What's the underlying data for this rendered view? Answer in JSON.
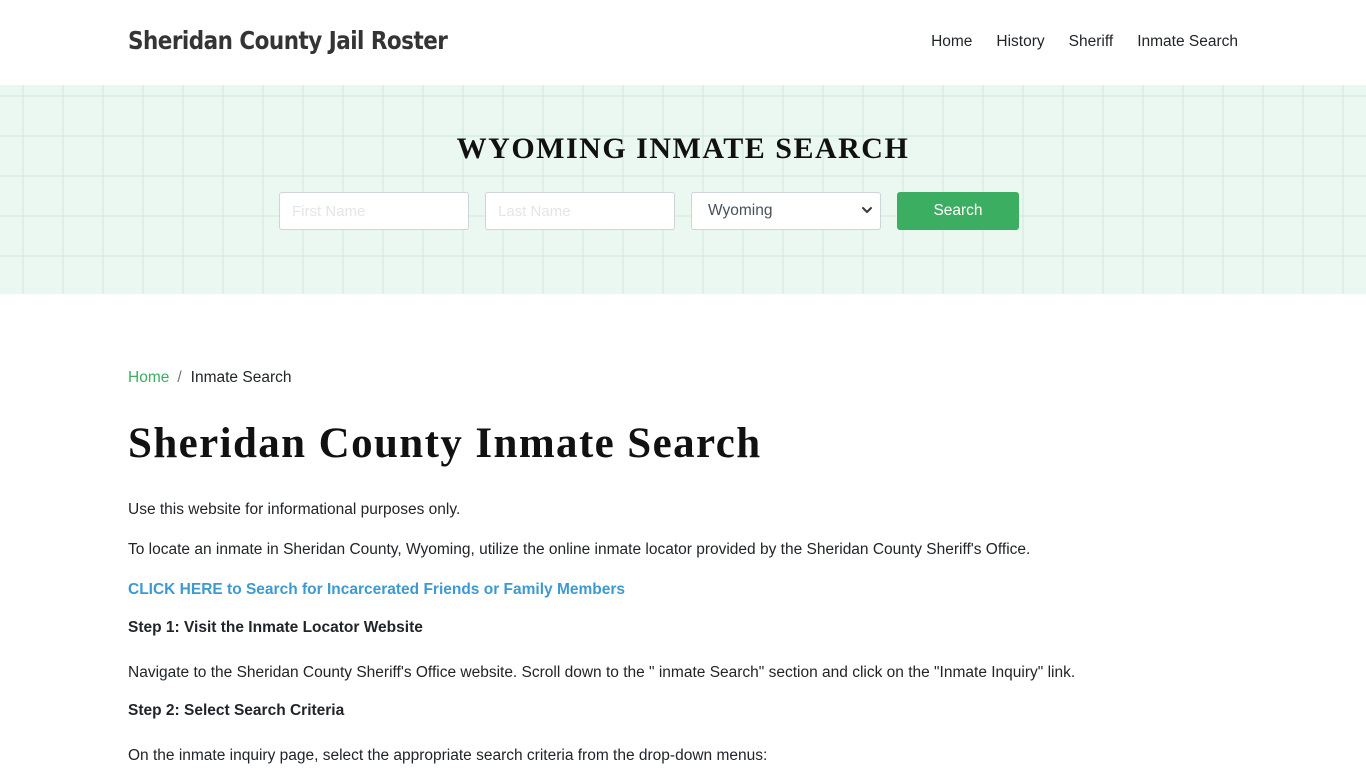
{
  "header": {
    "brand": "Sheridan County Jail Roster",
    "nav": [
      {
        "label": "Home"
      },
      {
        "label": "History"
      },
      {
        "label": "Sheriff"
      },
      {
        "label": "Inmate Search"
      }
    ]
  },
  "hero": {
    "title": "WYOMING INMATE SEARCH",
    "first_name": {
      "value": "",
      "placeholder": "First Name"
    },
    "last_name": {
      "value": "",
      "placeholder": "Last Name"
    },
    "state_select": {
      "selected": "Wyoming",
      "icon": "chevron-down-icon"
    },
    "search_button": "Search",
    "colors": {
      "background": "#eaf8f1",
      "button": "#3cae62"
    }
  },
  "breadcrumb": {
    "home": "Home",
    "separator": "/",
    "current": "Inmate Search"
  },
  "main": {
    "title": "Sheridan County Inmate Search",
    "intro": "Use this website for informational purposes only.",
    "locate_text": "To locate an inmate in Sheridan County, Wyoming, utilize the online inmate locator provided by the Sheridan County Sheriff's Office.",
    "cta_link": "CLICK HERE to Search for Incarcerated Friends or Family Members",
    "step1_heading": "Step 1: Visit the Inmate Locator Website",
    "step1_text": "Navigate to the Sheridan County Sheriff's Office website. Scroll down to the \" inmate Search\" section and click on the \"Inmate Inquiry\" link.",
    "step2_heading": "Step 2: Select Search Criteria",
    "step2_text": "On the inmate inquiry page, select the appropriate search criteria from the drop-down menus:",
    "colors": {
      "link": "#3d9ad1",
      "breadcrumb_link": "#3cae62"
    }
  }
}
